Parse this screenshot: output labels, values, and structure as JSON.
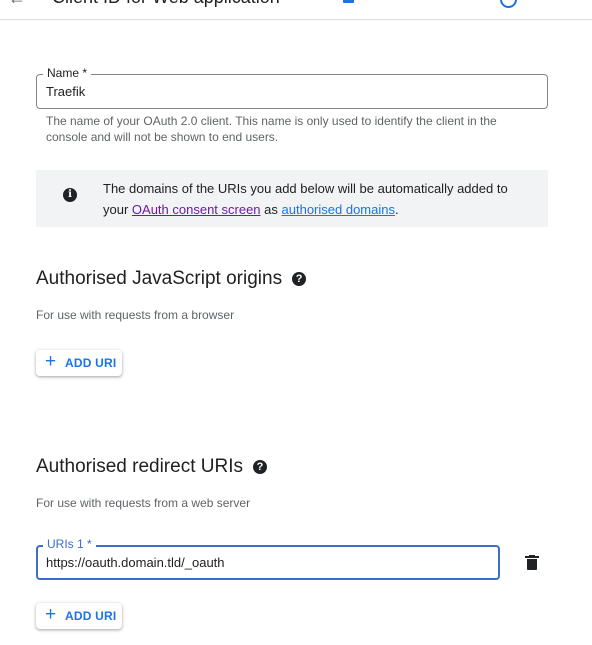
{
  "header": {
    "back_glyph": "←",
    "title": "Client ID for Web application"
  },
  "name_field": {
    "label": "Name *",
    "value": "Traefik",
    "hint": "The name of your OAuth 2.0 client. This name is only used to identify the client in the console and will not be shown to end users."
  },
  "notice": {
    "text_before": "The domains of the URIs you add below will be automatically added to your ",
    "link1": "OAuth consent screen",
    "text_middle": " as ",
    "link2": "authorised domains",
    "text_after": "."
  },
  "js_origins": {
    "title": "Authorised JavaScript origins",
    "description": "For use with requests from a browser",
    "add_button": "ADD URI"
  },
  "redirect_uris": {
    "title": "Authorised redirect URIs",
    "description": "For use with requests from a web server",
    "uri_label": "URIs 1 *",
    "uri_value": "https://oauth.domain.tld/_oauth",
    "add_button": "ADD URI"
  },
  "icons": {
    "help": "?",
    "info": "i",
    "plus": "+"
  },
  "colors": {
    "accent": "#1a73e8",
    "focus": "#3c6ec9",
    "visited_link": "#681da8",
    "notice_bg": "#f1f3f4"
  }
}
